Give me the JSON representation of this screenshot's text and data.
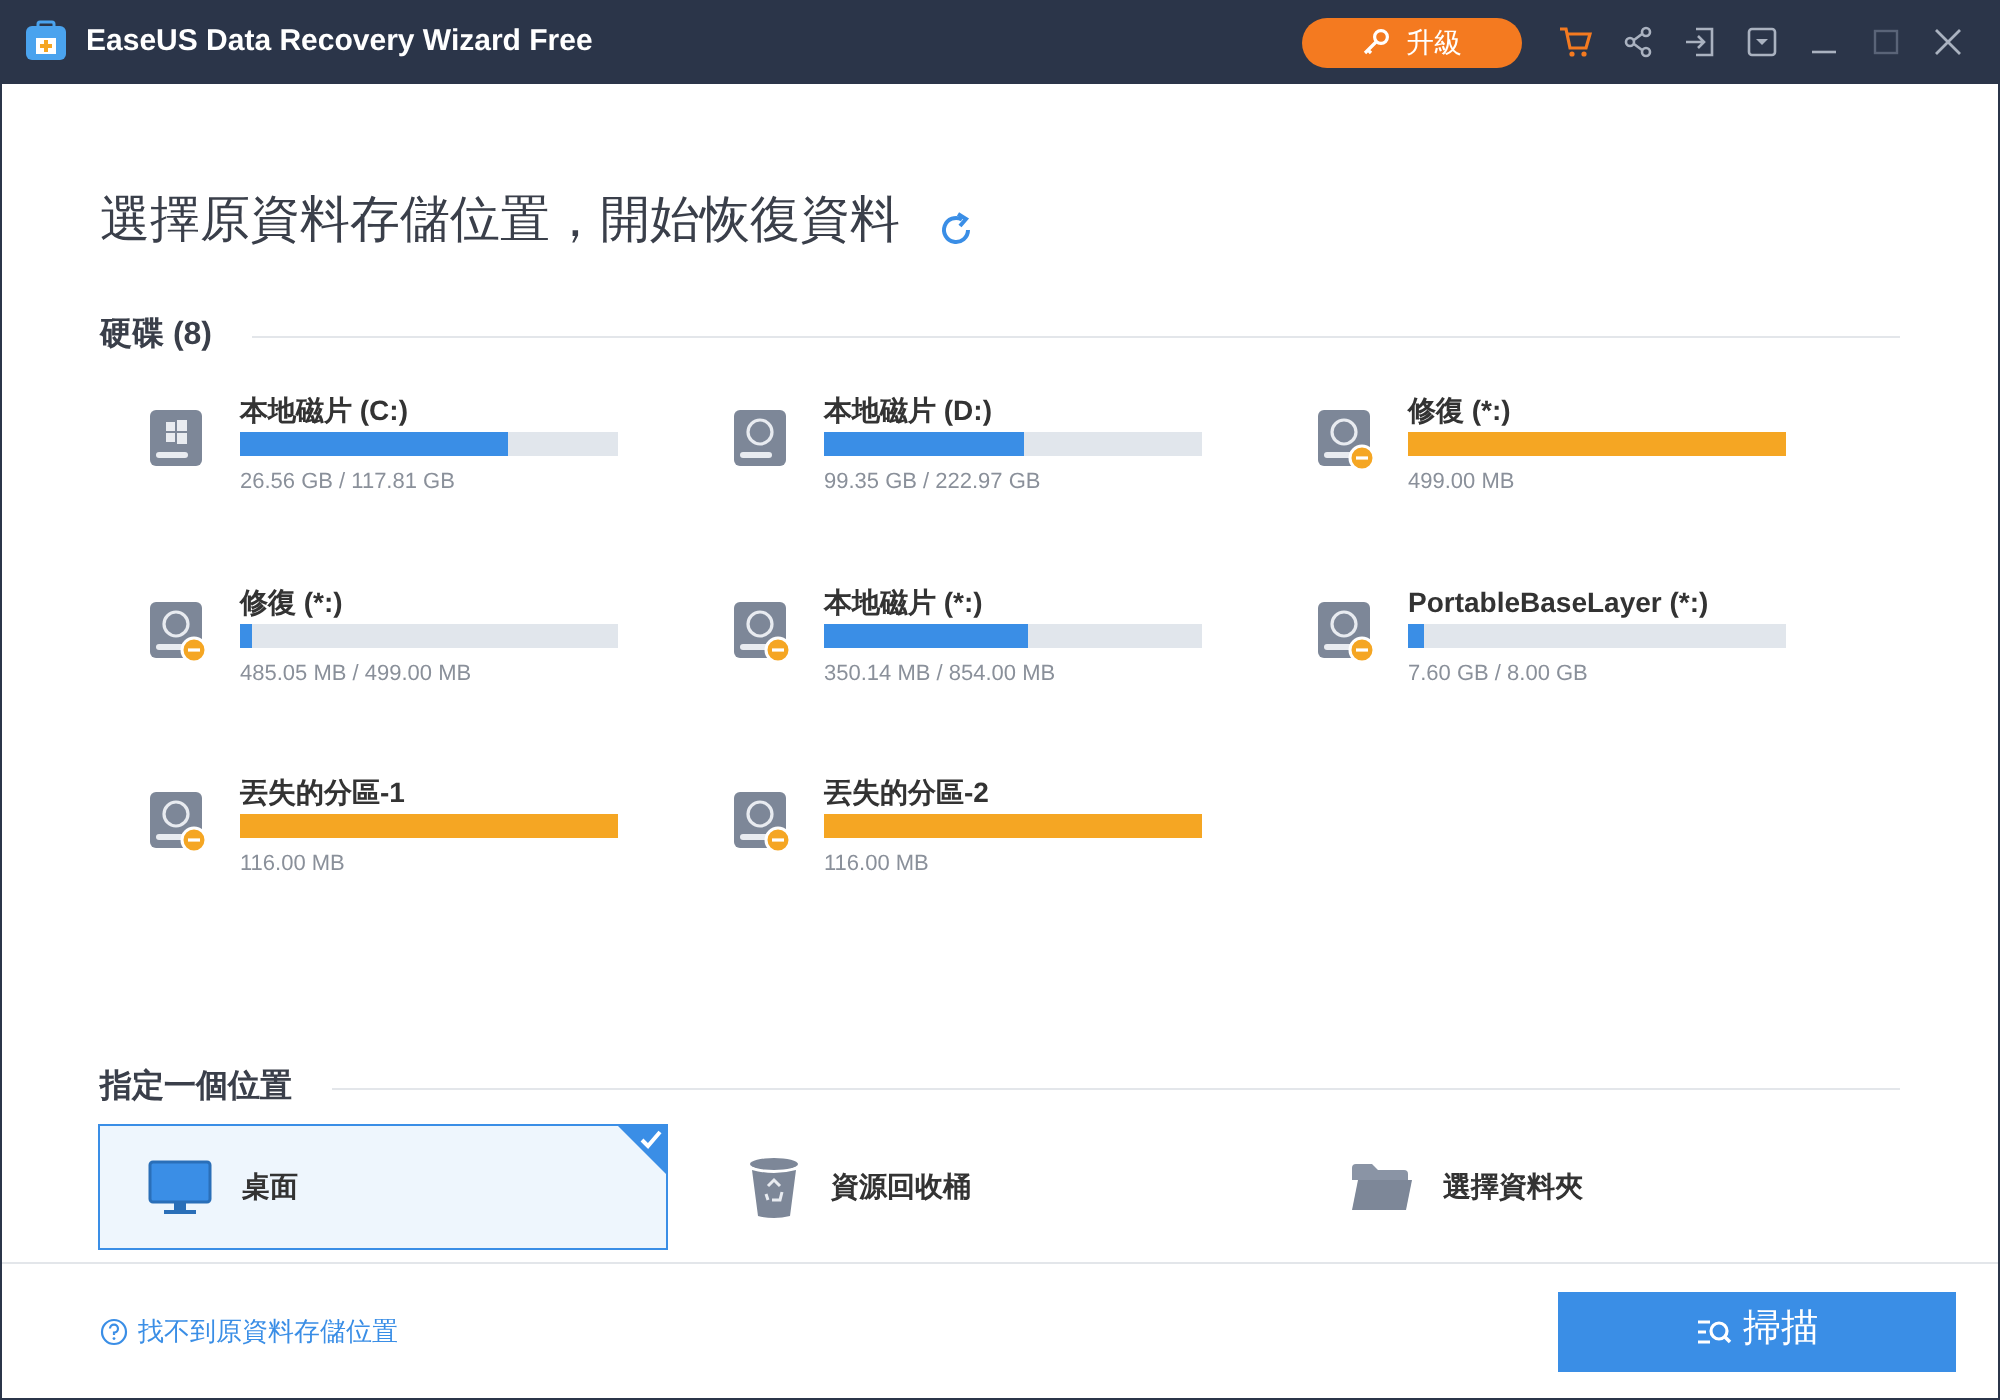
{
  "window": {
    "title": "EaseUS Data Recovery Wizard Free",
    "upgrade_label": "升級"
  },
  "heading": "選擇原資料存儲位置，開始恢復資料",
  "drives_section": {
    "title": "硬碟 (8)",
    "drives": [
      {
        "kind": "windows",
        "name": "本地磁片 (C:)",
        "level": 0.71,
        "color": "#3a8ee6",
        "size": "26.56 GB / 117.81 GB",
        "warning": false
      },
      {
        "kind": "disk",
        "name": "本地磁片 (D:)",
        "level": 0.53,
        "color": "#3a8ee6",
        "size": "99.35 GB / 222.97 GB",
        "warning": false
      },
      {
        "kind": "disk",
        "name": "修復 (*:)",
        "color": "#f5a623",
        "size": "499.00 MB",
        "warning": true
      },
      {
        "kind": "disk",
        "name": "修復 (*:)",
        "level": 0.03,
        "color": "#3a8ee6",
        "size": "485.05 MB / 499.00 MB",
        "warning": true
      },
      {
        "kind": "disk",
        "name": "本地磁片 (*:)",
        "level": 0.54,
        "color": "#3a8ee6",
        "size": "350.14 MB / 854.00 MB",
        "warning": true
      },
      {
        "kind": "disk",
        "name": "PortableBaseLayer (*:)",
        "level": 0.04,
        "color": "#3a8ee6",
        "size": "7.60 GB / 8.00 GB",
        "warning": true
      },
      {
        "kind": "disk",
        "name": "丟失的分區-1",
        "color": "#f5a623",
        "size": "116.00 MB",
        "warning": true
      },
      {
        "kind": "disk",
        "name": "丟失的分區-2",
        "color": "#f5a623",
        "size": "116.00 MB",
        "warning": true
      }
    ]
  },
  "locations_section": {
    "title": "指定一個位置",
    "locations": [
      {
        "kind": "desktop",
        "label": "桌面",
        "selected": true
      },
      {
        "kind": "recycle",
        "label": "資源回收桶",
        "selected": false
      },
      {
        "kind": "folder",
        "label": "選擇資料夾",
        "selected": false
      }
    ]
  },
  "footer": {
    "help_link": "找不到原資料存儲位置",
    "scan_button": "掃描"
  }
}
